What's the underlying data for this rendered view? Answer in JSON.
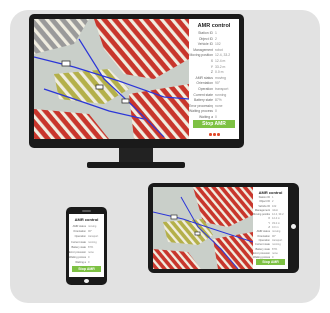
{
  "panel": {
    "title": "AMR control",
    "button_label": "Stop AMR",
    "monitor_rows": [
      {
        "label": "Station ID",
        "value": "1"
      },
      {
        "label": "Object ID",
        "value": "2"
      },
      {
        "label": "Vehicle ID",
        "value": "102"
      },
      {
        "label": "Management",
        "value": "robot"
      },
      {
        "label": "Moving position",
        "value": "12.4, 33.2"
      },
      {
        "label": "X",
        "value": "12.4 m"
      },
      {
        "label": "Y",
        "value": "33.2 m"
      },
      {
        "label": "Z",
        "value": "0.0 m"
      },
      {
        "label": "AMR status",
        "value": "moving"
      },
      {
        "label": "Orientation",
        "value": "90°"
      },
      {
        "label": "Operation",
        "value": "transport"
      },
      {
        "label": "Current state",
        "value": "running"
      },
      {
        "label": "Battery state",
        "value": "87%"
      },
      {
        "label": "Error processing",
        "value": "none"
      },
      {
        "label": "Waiting process",
        "value": "0"
      },
      {
        "label": "Waiting a",
        "value": "0"
      }
    ],
    "tablet_rows": [
      {
        "label": "Station ID",
        "value": "1"
      },
      {
        "label": "Object ID",
        "value": "2"
      },
      {
        "label": "Vehicle ID",
        "value": "102"
      },
      {
        "label": "Management",
        "value": "robot"
      },
      {
        "label": "Moving position",
        "value": "12.4, 33.2"
      },
      {
        "label": "X",
        "value": "12.4 m"
      },
      {
        "label": "Y",
        "value": "33.2 m"
      },
      {
        "label": "Z",
        "value": "0.0 m"
      },
      {
        "label": "AMR status",
        "value": "moving"
      },
      {
        "label": "Orientation",
        "value": "90°"
      },
      {
        "label": "Operation",
        "value": "transport"
      },
      {
        "label": "Current state",
        "value": "running"
      },
      {
        "label": "Battery state",
        "value": "87%"
      },
      {
        "label": "Error processing",
        "value": "none"
      },
      {
        "label": "Waiting process",
        "value": "0"
      }
    ],
    "phone_rows": [
      {
        "label": "AMR status",
        "value": "moving"
      },
      {
        "label": "Orientation",
        "value": "90°"
      },
      {
        "label": "Operation",
        "value": "transport"
      },
      {
        "label": "Current state",
        "value": "running"
      },
      {
        "label": "Battery state",
        "value": "87%"
      },
      {
        "label": "Error processing",
        "value": "none"
      },
      {
        "label": "Waiting process",
        "value": "0"
      },
      {
        "label": "Waiting a",
        "value": "0"
      }
    ]
  },
  "colors": {
    "accent_green": "#7dc143",
    "map_red": "#c8362c",
    "route_blue": "#2b35d8",
    "pagination": [
      "#e24a2b",
      "#e24a2b",
      "#e24a2b"
    ]
  },
  "icons": [
    "amr-vehicle-icon",
    "home-button-icon"
  ]
}
